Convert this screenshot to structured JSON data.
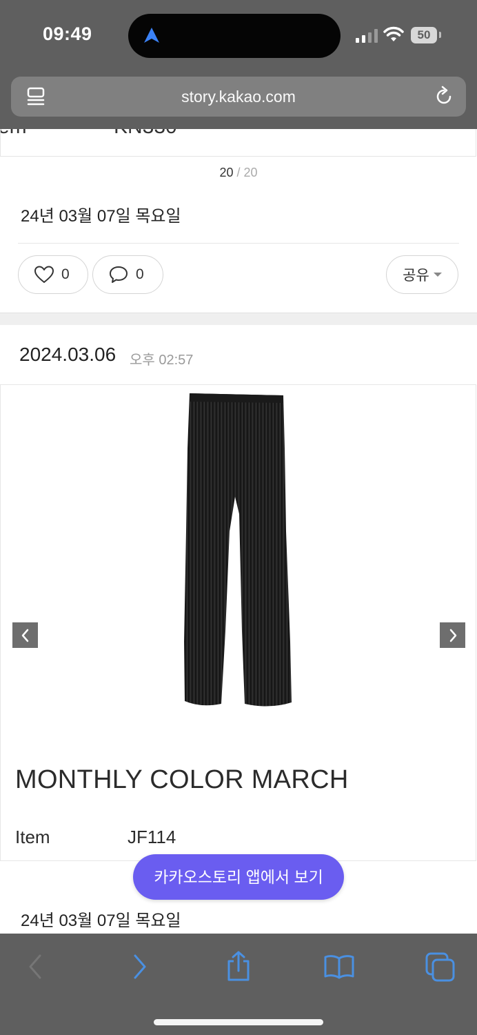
{
  "status_bar": {
    "time": "09:49",
    "battery": "50",
    "icons": [
      "location-arrow-icon",
      "signal-icon",
      "wifi-icon",
      "battery-icon"
    ]
  },
  "browser": {
    "url": "story.kakao.com",
    "reader_icon": "reader-mode-icon",
    "reload_icon": "reload-icon"
  },
  "previous_post": {
    "cut_label": "em",
    "cut_value": "KN330",
    "slide_current": "20",
    "slide_separator": "/",
    "slide_total": "20",
    "date": "24년 03월 07일 목요일",
    "like_count": "0",
    "comment_count": "0",
    "share_label": "공유"
  },
  "post": {
    "date": "2024.03.06",
    "time": "오후 02:57",
    "slide_title": "MONTHLY COLOR MARCH",
    "item_label": "Item",
    "item_value": "JF114",
    "date_line": "24년 03월 07일 목요일"
  },
  "cta": {
    "label": "카카오스토리 앱에서 보기",
    "color": "#6a5df0"
  },
  "toolbar": {
    "icons": [
      "back-icon",
      "forward-icon",
      "share-icon",
      "bookmarks-icon",
      "tabs-icon"
    ],
    "accent": "#4a90e2"
  }
}
